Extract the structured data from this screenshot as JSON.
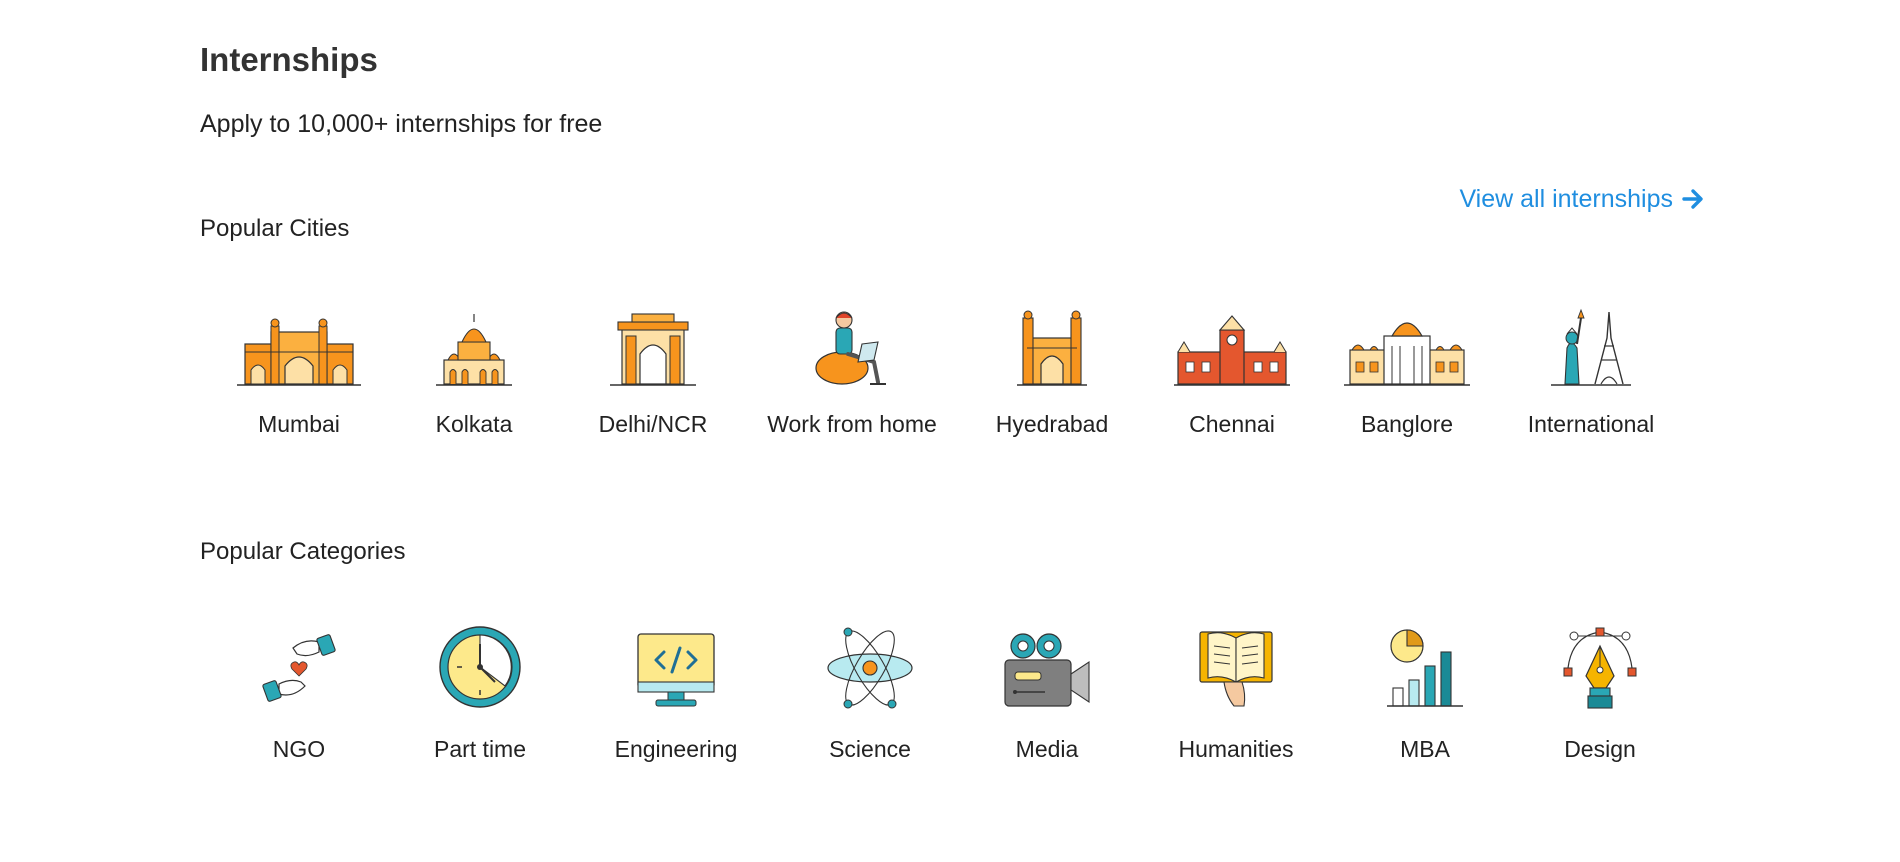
{
  "header": {
    "title": "Internships",
    "subtitle": "Apply to 10,000+ internships for free",
    "view_all_label": "View all internships"
  },
  "cities": {
    "title": "Popular Cities",
    "items": [
      {
        "label": "Mumbai",
        "icon": "gateway-of-india-icon"
      },
      {
        "label": "Kolkata",
        "icon": "dakshineswar-temple-icon"
      },
      {
        "label": "Delhi/NCR",
        "icon": "india-gate-icon"
      },
      {
        "label": "Work from home",
        "icon": "person-with-laptop-icon"
      },
      {
        "label": "Hyedrabad",
        "icon": "charminar-icon"
      },
      {
        "label": "Chennai",
        "icon": "chennai-central-icon"
      },
      {
        "label": "Banglore",
        "icon": "vidhana-soudha-icon"
      },
      {
        "label": "International",
        "icon": "statue-of-liberty-eiffel-icon"
      }
    ]
  },
  "categories": {
    "title": "Popular Categories",
    "items": [
      {
        "label": "NGO",
        "icon": "helping-hands-icon"
      },
      {
        "label": "Part time",
        "icon": "clock-icon"
      },
      {
        "label": "Engineering",
        "icon": "code-monitor-icon"
      },
      {
        "label": "Science",
        "icon": "atom-icon"
      },
      {
        "label": "Media",
        "icon": "video-camera-icon"
      },
      {
        "label": "Humanities",
        "icon": "open-book-icon"
      },
      {
        "label": "MBA",
        "icon": "bar-chart-icon"
      },
      {
        "label": "Design",
        "icon": "pen-tool-icon"
      }
    ]
  },
  "colors": {
    "link": "#1f8ee0",
    "orange": "#f7941d",
    "teal": "#2aa7b5",
    "yellow": "#fde98b"
  }
}
